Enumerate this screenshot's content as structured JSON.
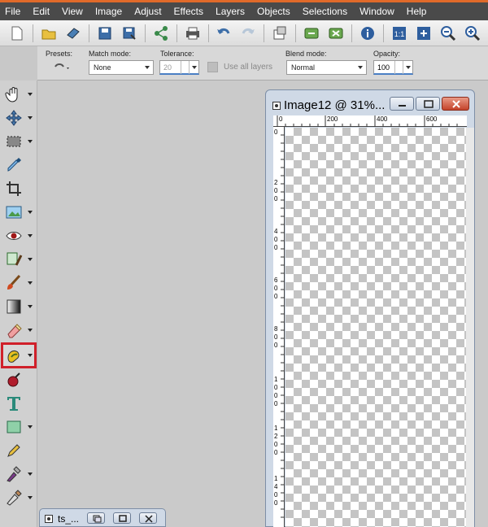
{
  "menu": [
    "File",
    "Edit",
    "View",
    "Image",
    "Adjust",
    "Effects",
    "Layers",
    "Objects",
    "Selections",
    "Window",
    "Help"
  ],
  "toolbar_icons": [
    "new-icon",
    "open-icon",
    "browse-icon",
    "save-icon",
    "save-as-icon",
    "share-icon",
    "print-icon",
    "undo-icon",
    "redo-icon",
    "resize-icon",
    "script-run-icon",
    "script-stop-icon",
    "info-icon",
    "actual-size-icon",
    "fit-icon",
    "zoom-out-icon",
    "zoom-in-icon"
  ],
  "options": {
    "presets_label": "Presets:",
    "match_mode_label": "Match mode:",
    "match_mode_value": "None",
    "tolerance_label": "Tolerance:",
    "tolerance_value": "20",
    "use_all_layers_label": "Use all layers",
    "blend_mode_label": "Blend mode:",
    "blend_mode_value": "Normal",
    "opacity_label": "Opacity:",
    "opacity_value": "100"
  },
  "tools": [
    "pan-icon",
    "move-icon",
    "selection-icon",
    "dropper-icon",
    "crop-icon",
    "picture-tube-icon",
    "red-eye-icon",
    "clone-icon",
    "paint-brush-icon",
    "gradient-icon",
    "eraser-icon",
    "flood-fill-icon",
    "color-replacer-icon",
    "text-icon",
    "shape-icon",
    "pen-icon",
    "art-media-icon",
    "smudge-icon"
  ],
  "active_tool": "flood-fill-icon",
  "image_window": {
    "title": "Image12 @  31%...",
    "ruler_top": [
      "0",
      "200",
      "400",
      "600"
    ],
    "ruler_left": [
      "0",
      "2 0 0",
      "4 0 0",
      "6 0 0",
      "8 0 0",
      "1 0 0 0",
      "1 2 0 0",
      "1 4 0 0"
    ]
  },
  "minimized_window": {
    "title": "ts_..."
  },
  "colors": {
    "accent": "#e06a2a",
    "active_outline": "#d0202a",
    "menubar": "#4a4a4a"
  }
}
